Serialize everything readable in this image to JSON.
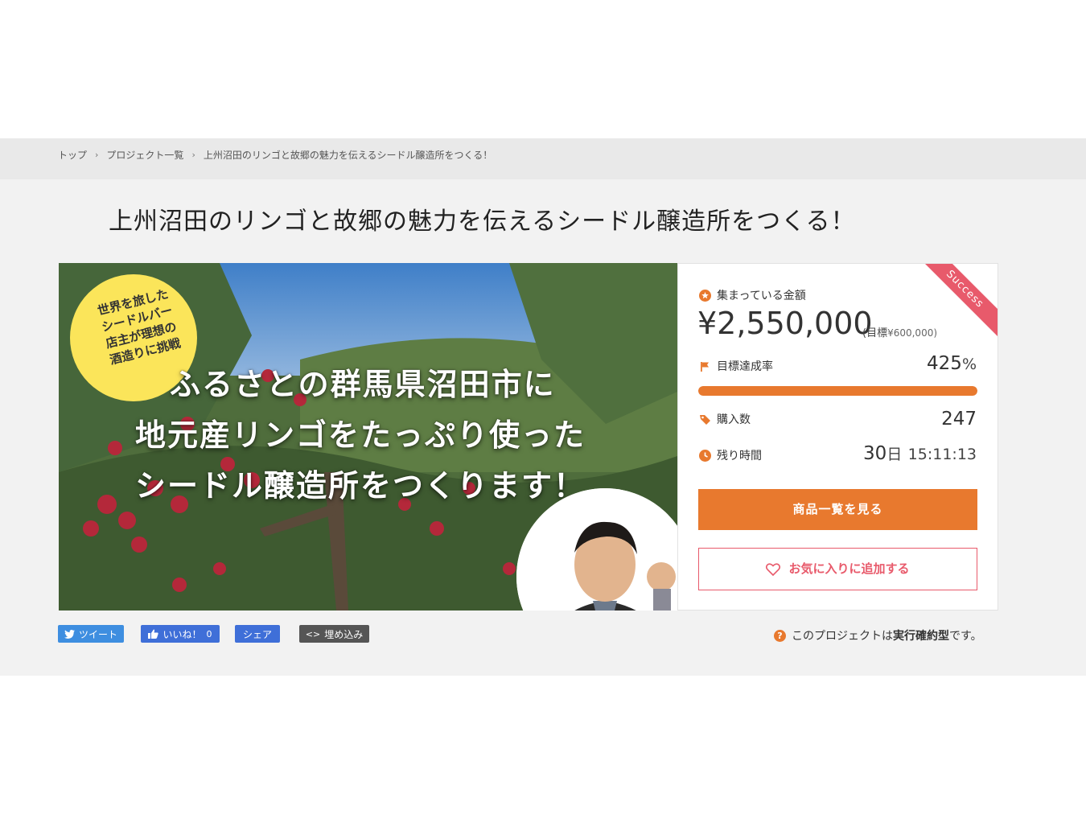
{
  "breadcrumb": {
    "items": [
      "トップ",
      "プロジェクト一覧",
      "上州沼田のリンゴと故郷の魅力を伝えるシードル醸造所をつくる！"
    ],
    "separator": "›"
  },
  "page_title": "上州沼田のリンゴと故郷の魅力を伝えるシードル醸造所をつくる！",
  "hero": {
    "badge_lines": [
      "世界を旅した",
      "シードルバー",
      "店主が理想の",
      "酒造りに挑戦"
    ],
    "headline_lines": [
      "ふるさとの群馬県沼田市に",
      "地元産リンゴをたっぷり使った",
      "シードル醸造所をつくります！"
    ]
  },
  "status": {
    "ribbon": "Success",
    "raised_label": "集まっている金額",
    "raised_amount": "¥2,550,000",
    "goal_prefix": "(目標",
    "goal_amount": "¥600,000)",
    "rate_label": "目標達成率",
    "rate_value": "425",
    "rate_unit": "%",
    "progress_fraction": 1.0,
    "purchases_label": "購入数",
    "purchases_value": "247",
    "time_label": "残り時間",
    "time_days": "30",
    "time_days_unit": "日",
    "time_clock": "15:11:13"
  },
  "buttons": {
    "items": "商品一覧を見る",
    "favorite": "お気に入りに追加する"
  },
  "share": {
    "tweet": "ツイート",
    "like": "いいね！",
    "like_count": "0",
    "share": "シェア",
    "embed": "埋め込み"
  },
  "note": {
    "prefix": "このプロジェクトは",
    "type": "実行確約型",
    "suffix": "です。"
  },
  "colors": {
    "accent": "#e8792e",
    "favorite": "#e85a6b",
    "twitter": "#3e8ee0",
    "facebook": "#3f6fd8"
  }
}
